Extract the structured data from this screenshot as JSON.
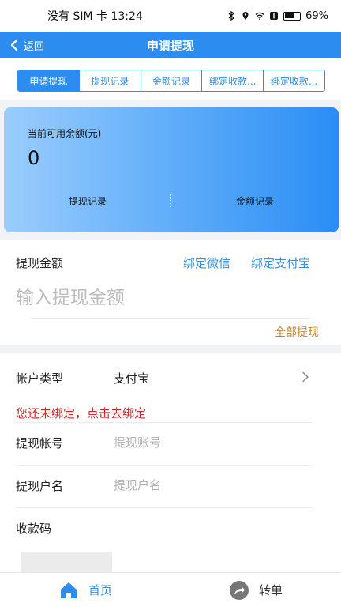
{
  "status_bar": {
    "carrier_time": "没有 SIM 卡 13:24",
    "battery": "69%"
  },
  "nav": {
    "back_label": "返回",
    "title": "申请提现"
  },
  "tabs": [
    {
      "label": "申请提现",
      "active": true
    },
    {
      "label": "提现记录",
      "active": false
    },
    {
      "label": "金额记录",
      "active": false
    },
    {
      "label": "绑定收款...",
      "active": false
    },
    {
      "label": "绑定收款...",
      "active": false
    }
  ],
  "balance_card": {
    "label": "当前可用余额(元)",
    "amount": "0",
    "link_withdraw_records": "提现记录",
    "link_amount_records": "金额记录"
  },
  "withdraw_amount": {
    "title": "提现金额",
    "bind_wechat": "绑定微信",
    "bind_alipay": "绑定支付宝",
    "placeholder": "输入提现金额",
    "value": "",
    "all_withdraw": "全部提现"
  },
  "account": {
    "type_label": "帐户类型",
    "type_value": "支付宝",
    "bind_warning": "您还未绑定，点击去绑定",
    "account_no_label": "提现帐号",
    "account_no_placeholder": "提现账号",
    "account_name_label": "提现户名",
    "account_name_placeholder": "提现户名",
    "qr_label": "收款码"
  },
  "bottom_nav": {
    "home": "首页",
    "transfer": "转单"
  },
  "colors": {
    "primary": "#2c8cf0",
    "link": "#3b8fd6",
    "warning": "#d0262a",
    "accent_orange": "#c9822b"
  }
}
